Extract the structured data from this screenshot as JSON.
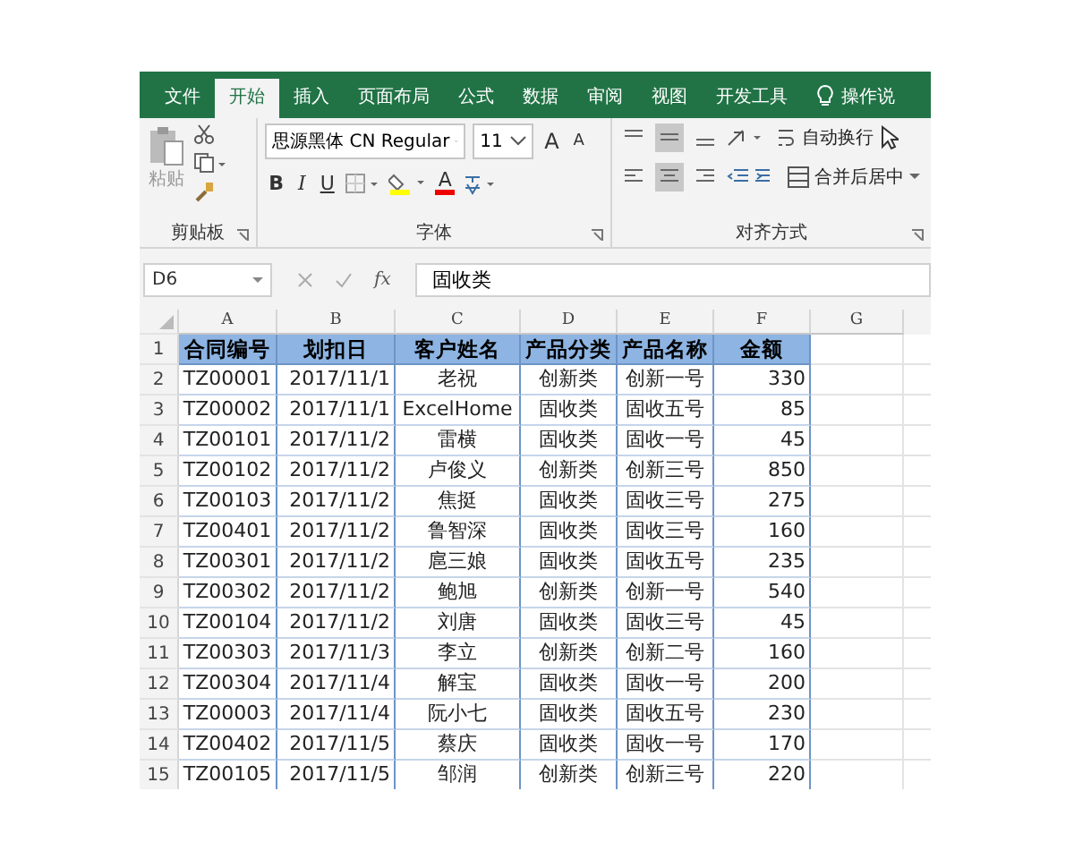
{
  "tabs": [
    {
      "label": "文件",
      "selected": false
    },
    {
      "label": "开始",
      "selected": true
    },
    {
      "label": "插入",
      "selected": false
    },
    {
      "label": "页面布局",
      "selected": false
    },
    {
      "label": "公式",
      "selected": false
    },
    {
      "label": "数据",
      "selected": false
    },
    {
      "label": "审阅",
      "selected": false
    },
    {
      "label": "视图",
      "selected": false
    },
    {
      "label": "开发工具",
      "selected": false
    }
  ],
  "tell_me": "操作说",
  "clipboard": {
    "paste_label": "粘贴",
    "group_label": "剪贴板"
  },
  "font": {
    "font_name": "思源黑体 CN Regular",
    "font_size": "11",
    "grow_label": "A",
    "shrink_label": "A",
    "style_buttons": [
      "B",
      "I",
      "U"
    ],
    "font_color_label": "A",
    "group_label": "字体"
  },
  "alignment": {
    "vertical": [
      {
        "selected": false
      },
      {
        "selected": true
      },
      {
        "selected": false
      }
    ],
    "horizontal": [
      {
        "selected": false
      },
      {
        "selected": true
      },
      {
        "selected": false
      }
    ],
    "wrap_label": "自动换行",
    "merge_label": "合并后居中",
    "group_label": "对齐方式"
  },
  "formula_bar": {
    "name_box": "D6",
    "fx": "fx",
    "value": "固收类"
  },
  "sheet": {
    "columns": [
      "A",
      "B",
      "C",
      "D",
      "E",
      "F",
      "G"
    ],
    "row_numbers": [
      "1",
      "2",
      "3",
      "4",
      "5",
      "6",
      "7",
      "8",
      "9",
      "10",
      "11",
      "12",
      "13",
      "14",
      "15"
    ],
    "header": [
      "合同编号",
      "划扣日",
      "客户姓名",
      "产品分类",
      "产品名称",
      "金额"
    ],
    "rows": [
      [
        "TZ00001",
        "2017/11/1",
        "老祝",
        "创新类",
        "创新一号",
        "330"
      ],
      [
        "TZ00002",
        "2017/11/1",
        "ExcelHome",
        "固收类",
        "固收五号",
        "85"
      ],
      [
        "TZ00101",
        "2017/11/2",
        "雷横",
        "固收类",
        "固收一号",
        "45"
      ],
      [
        "TZ00102",
        "2017/11/2",
        "卢俊义",
        "创新类",
        "创新三号",
        "850"
      ],
      [
        "TZ00103",
        "2017/11/2",
        "焦挺",
        "固收类",
        "固收三号",
        "275"
      ],
      [
        "TZ00401",
        "2017/11/2",
        "鲁智深",
        "固收类",
        "固收三号",
        "160"
      ],
      [
        "TZ00301",
        "2017/11/2",
        "扈三娘",
        "固收类",
        "固收五号",
        "235"
      ],
      [
        "TZ00302",
        "2017/11/2",
        "鲍旭",
        "创新类",
        "创新一号",
        "540"
      ],
      [
        "TZ00104",
        "2017/11/2",
        "刘唐",
        "固收类",
        "固收三号",
        "45"
      ],
      [
        "TZ00303",
        "2017/11/3",
        "李立",
        "创新类",
        "创新二号",
        "160"
      ],
      [
        "TZ00304",
        "2017/11/4",
        "解宝",
        "固收类",
        "固收一号",
        "200"
      ],
      [
        "TZ00003",
        "2017/11/4",
        "阮小七",
        "固收类",
        "固收五号",
        "230"
      ],
      [
        "TZ00402",
        "2017/11/5",
        "蔡庆",
        "固收类",
        "固收一号",
        "170"
      ],
      [
        "TZ00105",
        "2017/11/5",
        "邹润",
        "创新类",
        "创新三号",
        "220"
      ]
    ]
  }
}
